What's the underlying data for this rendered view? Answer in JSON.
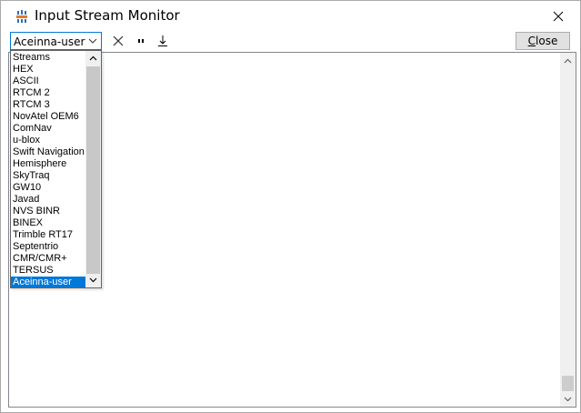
{
  "window": {
    "title": "Input Stream Monitor"
  },
  "toolbar": {
    "stream_selector_value": "Aceinna-user",
    "clear_icon": "clear-x-icon",
    "pause_icon": "pause-icon",
    "download_icon": "download-icon",
    "close_label_mnemonic": "C",
    "close_label_rest": "lose"
  },
  "dropdown": {
    "items": [
      {
        "label": "Streams"
      },
      {
        "label": "HEX"
      },
      {
        "label": "ASCII"
      },
      {
        "label": "RTCM 2"
      },
      {
        "label": "RTCM 3"
      },
      {
        "label": "NovAtel OEM6"
      },
      {
        "label": "ComNav"
      },
      {
        "label": "u-blox"
      },
      {
        "label": "Swift Navigation"
      },
      {
        "label": "Hemisphere"
      },
      {
        "label": "SkyTraq"
      },
      {
        "label": "GW10"
      },
      {
        "label": "Javad"
      },
      {
        "label": "NVS BINR"
      },
      {
        "label": "BINEX"
      },
      {
        "label": "Trimble RT17"
      },
      {
        "label": "Septentrio"
      },
      {
        "label": "CMR/CMR+"
      },
      {
        "label": "TERSUS"
      },
      {
        "label": "Aceinna-user"
      }
    ],
    "selected_index": 19
  },
  "colors": {
    "selection": "#0078d7",
    "focus_border": "#0078d7",
    "button_face": "#e1e1e1"
  }
}
